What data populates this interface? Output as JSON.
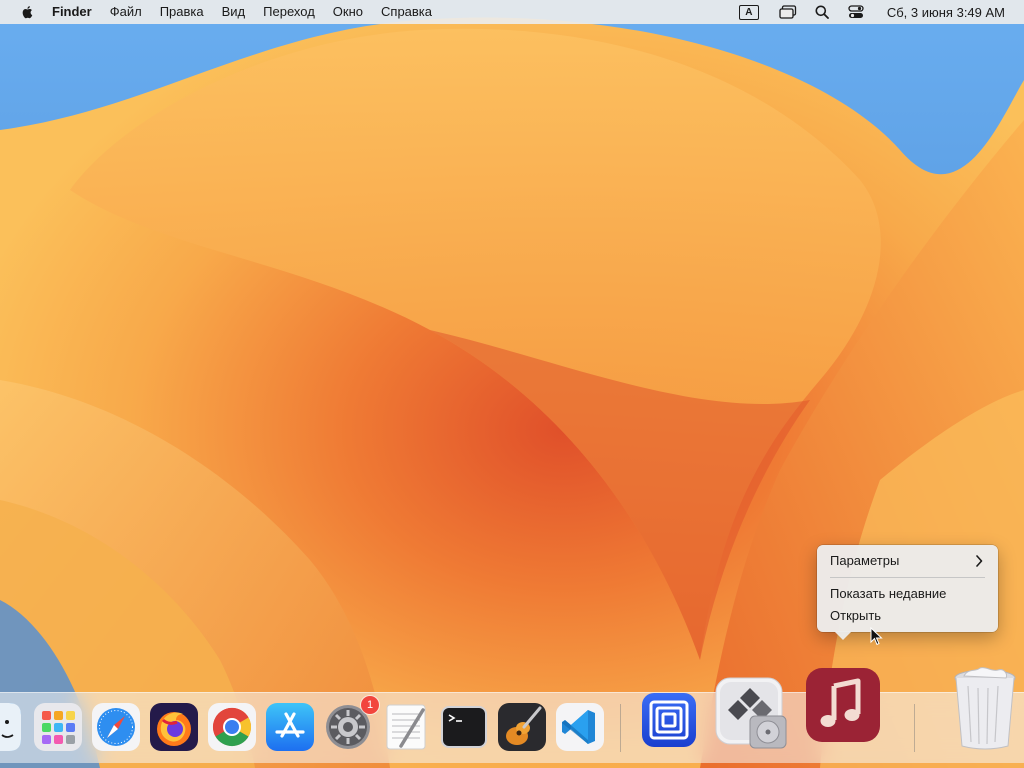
{
  "menubar": {
    "app_name": "Finder",
    "items": [
      "Файл",
      "Правка",
      "Вид",
      "Переход",
      "Окно",
      "Справка"
    ],
    "input_source": "A",
    "clock": "Сб, 3 июня  3:49 AM"
  },
  "context_menu": {
    "items": [
      {
        "label": "Параметры",
        "has_submenu": true
      },
      {
        "label": "Показать недавние",
        "has_submenu": false
      },
      {
        "label": "Открыть",
        "has_submenu": false
      }
    ]
  },
  "dock": {
    "items": [
      {
        "name": "finder",
        "icon": "finder-icon"
      },
      {
        "name": "launchpad",
        "icon": "launchpad-icon"
      },
      {
        "name": "safari",
        "icon": "safari-icon"
      },
      {
        "name": "firefox",
        "icon": "firefox-icon"
      },
      {
        "name": "chrome",
        "icon": "chrome-icon"
      },
      {
        "name": "app-store",
        "icon": "app-store-icon"
      },
      {
        "name": "system-settings",
        "icon": "gear-icon",
        "badge": "1"
      },
      {
        "name": "textedit",
        "icon": "textedit-icon"
      },
      {
        "name": "terminal",
        "icon": "terminal-icon"
      },
      {
        "name": "garageband",
        "icon": "guitar-icon"
      },
      {
        "name": "vscode",
        "icon": "vscode-icon"
      },
      {
        "name": "parallels",
        "icon": "parallels-icon"
      },
      {
        "name": "boot-camp-assistant",
        "icon": "boot-camp-icon"
      },
      {
        "name": "music",
        "icon": "music-icon"
      },
      {
        "name": "trash",
        "icon": "trash-icon"
      }
    ]
  },
  "colors": {
    "menubar_bg": "#ececec",
    "wallpaper_orange": "#f0a040",
    "wallpaper_blue": "#5b9bd8",
    "badge_red": "#f2453d"
  }
}
